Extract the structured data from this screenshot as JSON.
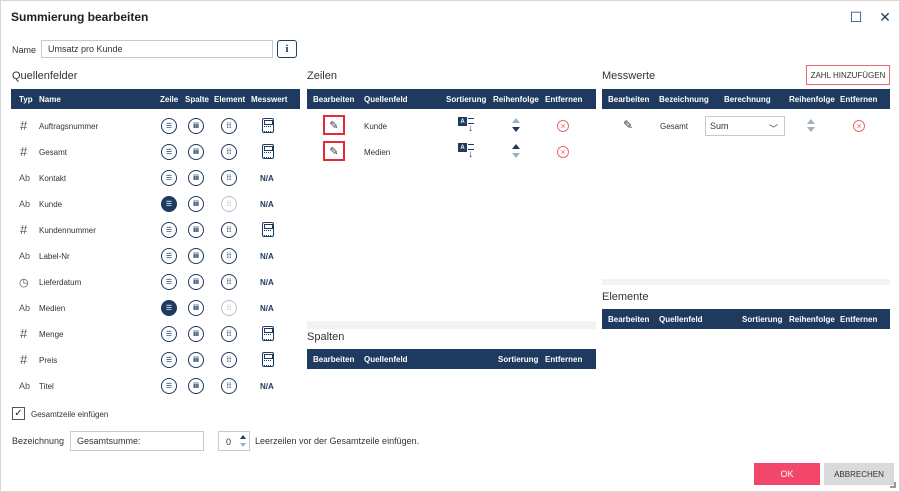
{
  "window": {
    "title": "Summierung bearbeiten",
    "maximize_glyph": "☐",
    "close_glyph": "✕"
  },
  "name_field": {
    "label": "Name",
    "value": "Umsatz pro Kunde",
    "info_glyph": "i"
  },
  "quellenfelder": {
    "title": "Quellenfelder",
    "headers": {
      "typ": "Typ",
      "name": "Name",
      "zeile": "Zeile",
      "spalte": "Spalte",
      "element": "Element",
      "messwert": "Messwert"
    },
    "rows": [
      {
        "type": "#",
        "name": "Auftragsnummer",
        "zeile": "normal",
        "spalte": "normal",
        "element": "normal",
        "messwert": "calc"
      },
      {
        "type": "#",
        "name": "Gesamt",
        "zeile": "normal",
        "spalte": "normal",
        "element": "normal",
        "messwert": "calc"
      },
      {
        "type": "Ab",
        "name": "Kontakt",
        "zeile": "normal",
        "spalte": "normal",
        "element": "normal",
        "messwert": "N/A"
      },
      {
        "type": "Ab",
        "name": "Kunde",
        "zeile": "filled",
        "spalte": "normal",
        "element": "faded",
        "messwert": "N/A"
      },
      {
        "type": "#",
        "name": "Kundennummer",
        "zeile": "normal",
        "spalte": "normal",
        "element": "normal",
        "messwert": "calc"
      },
      {
        "type": "Ab",
        "name": "Label-Nr",
        "zeile": "normal",
        "spalte": "normal",
        "element": "normal",
        "messwert": "N/A"
      },
      {
        "type": "clock",
        "name": "Lieferdatum",
        "zeile": "normal",
        "spalte": "normal",
        "element": "normal",
        "messwert": "N/A"
      },
      {
        "type": "Ab",
        "name": "Medien",
        "zeile": "filled",
        "spalte": "normal",
        "element": "faded",
        "messwert": "N/A"
      },
      {
        "type": "#",
        "name": "Menge",
        "zeile": "normal",
        "spalte": "normal",
        "element": "normal",
        "messwert": "calc"
      },
      {
        "type": "#",
        "name": "Preis",
        "zeile": "normal",
        "spalte": "normal",
        "element": "normal",
        "messwert": "calc"
      },
      {
        "type": "Ab",
        "name": "Titel",
        "zeile": "normal",
        "spalte": "normal",
        "element": "normal",
        "messwert": "N/A"
      }
    ]
  },
  "zeilen": {
    "title": "Zeilen",
    "headers": {
      "bearbeiten": "Bearbeiten",
      "quellenfeld": "Quellenfeld",
      "sortierung": "Sortierung",
      "reihenfolge": "Reihenfolge",
      "entfernen": "Entfernen"
    },
    "rows": [
      {
        "quellenfeld": "Kunde"
      },
      {
        "quellenfeld": "Medien"
      }
    ]
  },
  "spalten": {
    "title": "Spalten",
    "headers": {
      "bearbeiten": "Bearbeiten",
      "quellenfeld": "Quellenfeld",
      "sortierung": "Sortierung",
      "entfernen": "Entfernen"
    }
  },
  "messwerte": {
    "title": "Messwerte",
    "add_button": "ZAHL HINZUFÜGEN",
    "headers": {
      "bearbeiten": "Bearbeiten",
      "bezeichnung": "Bezeichnung",
      "berechnung": "Berechnung",
      "reihenfolge": "Reihenfolge",
      "entfernen": "Entfernen"
    },
    "rows": [
      {
        "bezeichnung": "Gesamt",
        "berechnung": "Sum"
      }
    ]
  },
  "elemente": {
    "title": "Elemente",
    "headers": {
      "bearbeiten": "Bearbeiten",
      "quellenfeld": "Quellenfeld",
      "sortierung": "Sortierung",
      "reihenfolge": "Reihenfolge",
      "entfernen": "Entfernen"
    }
  },
  "footer": {
    "checkbox_label": "Gesamtzeile einfügen",
    "checkbox_checked": true,
    "bezeichnung_label": "Bezeichnung",
    "bezeichnung_value": "Gesamtsumme:",
    "leerzeilen_value": "0",
    "leerzeilen_label": "Leerzeilen vor der Gesamtzeile einfügen.",
    "ok": "OK",
    "cancel": "ABBRECHEN"
  },
  "icons": {
    "zeile": "list-icon",
    "spalte": "columns-icon",
    "element": "grid-icon",
    "messwert": "calculator-icon",
    "edit": "pencil-icon",
    "remove": "remove-circle-icon"
  },
  "colors": {
    "header_bg": "#1e3a5f",
    "accent_red": "#e32b35",
    "ok_button": "#f2466a"
  }
}
